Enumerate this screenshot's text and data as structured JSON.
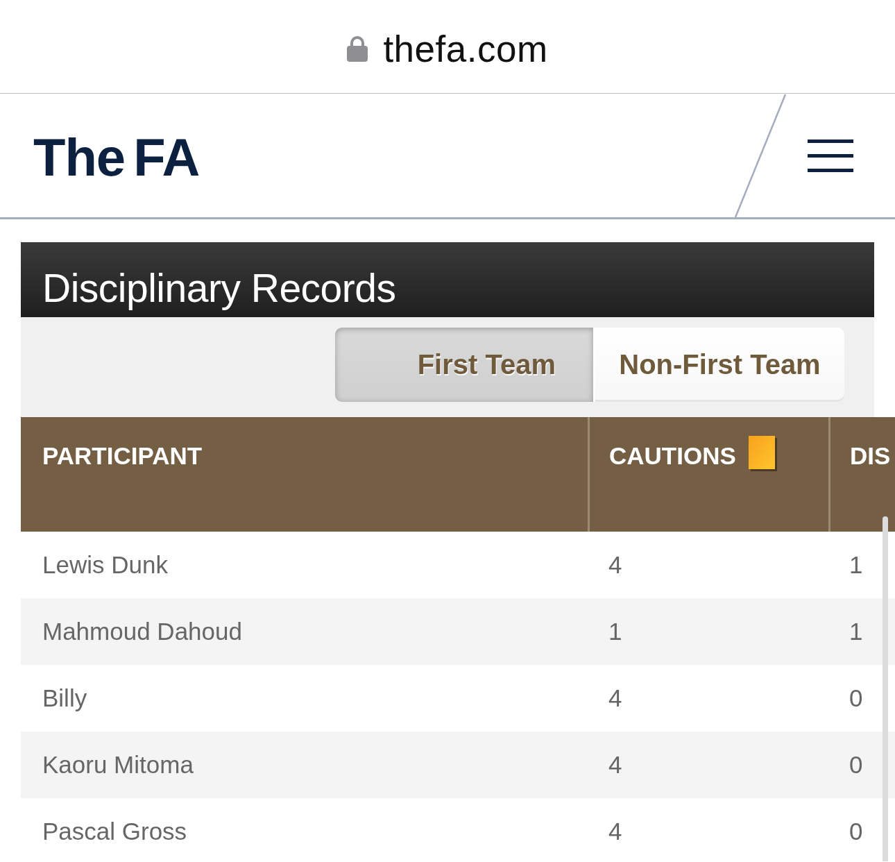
{
  "browser": {
    "address": "thefa.com"
  },
  "header": {
    "logo": "The FA"
  },
  "panel": {
    "title": "Disciplinary Records",
    "tabs": [
      {
        "label": "First Team",
        "selected": true
      },
      {
        "label": "Non-First Team",
        "selected": false
      }
    ]
  },
  "table": {
    "columns": [
      {
        "label": "PARTICIPANT",
        "kind": "plain"
      },
      {
        "label": "CAUTIONS",
        "kind": "card"
      },
      {
        "label": "DIS",
        "kind": "plain"
      }
    ],
    "rows": [
      {
        "cells": [
          "Lewis Dunk",
          "4",
          "1"
        ]
      },
      {
        "cells": [
          "Mahmoud Dahoud",
          "1",
          "1"
        ]
      },
      {
        "cells": [
          "Billy",
          "4",
          "0"
        ]
      },
      {
        "cells": [
          "Kaoru Mitoma",
          "4",
          "0"
        ]
      },
      {
        "cells": [
          "Pascal Gross",
          "4",
          "0"
        ]
      }
    ]
  }
}
